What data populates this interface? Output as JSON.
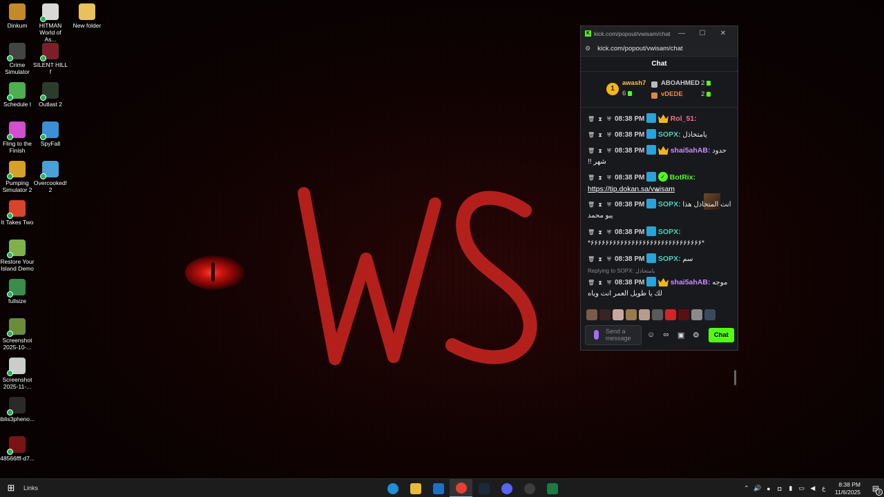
{
  "desktop": {
    "icons": [
      {
        "label": "Dinkum",
        "color": "#c48a2a"
      },
      {
        "label": "HITMAN World of As...",
        "color": "#d9d9d9"
      },
      {
        "label": "New folder",
        "color": "#e8c15a"
      },
      {
        "label": "Crime Simulator",
        "color": "#444444"
      },
      {
        "label": "SILENT HILL f",
        "color": "#7b1f2a"
      },
      {
        "label": "Schedule I",
        "color": "#4caf50"
      },
      {
        "label": "Outlast 2",
        "color": "#2d3b2d"
      },
      {
        "label": "Fling to the Finish",
        "color": "#d24fd0"
      },
      {
        "label": "SpyFall",
        "color": "#3b8fd6"
      },
      {
        "label": "Pumping Simulator 2",
        "color": "#d6a12b"
      },
      {
        "label": "Overcooked! 2",
        "color": "#4aa0d9"
      },
      {
        "label": "It Takes Two",
        "color": "#d9442b"
      },
      {
        "label": "Restore Your Island Demo",
        "color": "#7fb24a"
      },
      {
        "label": "fullsize",
        "color": "#3a8d4a"
      },
      {
        "label": "Screenshot 2025-10-...",
        "color": "#6b8d3a"
      },
      {
        "label": "Screenshot 2025-11-...",
        "color": "#cccccc"
      },
      {
        "label": "iblis3pheno...",
        "color": "#2a2a2a"
      },
      {
        "label": "48566fff-d7...",
        "color": "#7a1414"
      }
    ]
  },
  "wallpaper": {
    "logo_text": "WS",
    "logo_color": "#b3201c"
  },
  "chat_window": {
    "title": "kick.com/popout/vwisam/chat -...",
    "url": "kick.com/popout/vwisam/chat",
    "heading": "Chat",
    "leaderboard": {
      "rank": "1",
      "first": {
        "name": "awash7",
        "count": "6"
      },
      "second": {
        "name": "ABOAHMED",
        "count": "2"
      },
      "third": {
        "name": "vDEDE",
        "count": "2"
      }
    },
    "messages": [
      {
        "time": "08:38 PM",
        "user": "Rol_51:",
        "color": "#ff6b8a",
        "text": ""
      },
      {
        "time": "08:38 PM",
        "user": "SOPX:",
        "color": "#4fd0b4",
        "text": "يامتخاذل"
      },
      {
        "time": "08:38 PM",
        "user": "shai5ahAB:",
        "color": "#c98bff",
        "text": "حدود شهر !!"
      },
      {
        "time": "08:38 PM",
        "user": "BotRix:",
        "color": "#53fc18",
        "link": "https://tip.dokan.sa/vwisam"
      },
      {
        "time": "08:38 PM",
        "user": "SOPX:",
        "color": "#4fd0b4",
        "text": "انت المتخاذل هذا يبو محمد"
      },
      {
        "time": "08:38 PM",
        "user": "SOPX:",
        "color": "#4fd0b4",
        "text": "*۶۶۶۶۶۶۶۶۶۶۶۶۶۶۶۶۶۶۶۶۶۶۶۶۶۶۶۶۶۶*"
      },
      {
        "time": "08:38 PM",
        "user": "SOPX:",
        "color": "#4fd0b4",
        "text": "سم"
      },
      {
        "time": "08:38 PM",
        "user": "shai5ahAB:",
        "color": "#c98bff",
        "text": "موجه لك يا طويل العمر انت وياه",
        "reply": "Replying to SOPX: يامتخاذل"
      }
    ],
    "input_placeholder": "Send a message",
    "send_label": "Chat"
  },
  "taskbar": {
    "links_label": "Links",
    "time": "8:38 PM",
    "date": "11/6/2025",
    "lang": "ع",
    "notifications": "3",
    "apps": [
      {
        "name": "edge",
        "color": "#1f8fd6"
      },
      {
        "name": "file-explorer",
        "color": "#e8b93a"
      },
      {
        "name": "outlook",
        "color": "#1f6fc4"
      },
      {
        "name": "chrome",
        "color": "#e34133"
      },
      {
        "name": "steam",
        "color": "#1b2a3a"
      },
      {
        "name": "discord",
        "color": "#5865f2"
      },
      {
        "name": "obs",
        "color": "#3c3c3c"
      },
      {
        "name": "excel",
        "color": "#1d7a45"
      }
    ]
  }
}
